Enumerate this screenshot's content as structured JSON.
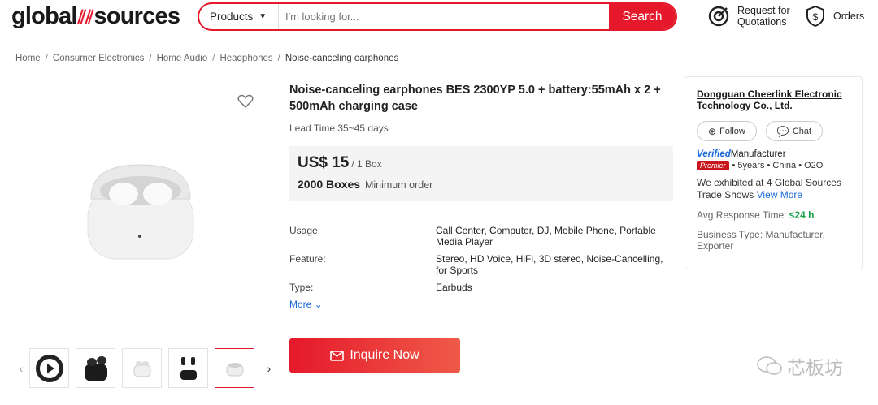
{
  "header": {
    "logo_left": "global",
    "logo_right": "sources",
    "category": "Products",
    "search_placeholder": "I'm looking for...",
    "search_button": "Search",
    "rfq_line1": "Request for",
    "rfq_line2": "Quotations",
    "orders": "Orders"
  },
  "breadcrumb": [
    "Home",
    "Consumer Electronics",
    "Home Audio",
    "Headphones",
    "Noise-canceling earphones"
  ],
  "product": {
    "title": "Noise-canceling earphones BES 2300YP 5.0 + battery:55mAh x 2 + 500mAh charging case",
    "lead_time": "Lead Time 35~45 days",
    "price": "US$ 15",
    "price_unit": "/ 1 Box",
    "moq": "2000 Boxes",
    "moq_label": "Minimum order",
    "attributes": [
      {
        "label": "Usage:",
        "value": "Call Center, Computer, DJ, Mobile Phone, Portable Media Player"
      },
      {
        "label": "Feature:",
        "value": "Stereo, HD Voice, HiFi, 3D stereo, Noise-Cancelling, for Sports"
      },
      {
        "label": "Type:",
        "value": "Earbuds"
      }
    ],
    "more": "More",
    "inquire": "Inquire Now"
  },
  "supplier": {
    "name": "Dongguan Cheerlink Electronic Technology Co., Ltd.",
    "follow": "Follow",
    "chat": "Chat",
    "verified": "Verified",
    "manufacturer": "Manufacturer",
    "premier": "Premier",
    "meta": "• 5years • China • O2O",
    "exhibited": "We exhibited at 4 Global Sources Trade Shows",
    "view_more": "View More",
    "avg_label": "Avg Response Time:",
    "avg_value": "≤24 h",
    "business": "Business Type: Manufacturer, Exporter"
  },
  "watermark": "芯板坊",
  "colors": {
    "brand": "#e5192b",
    "link": "#1a6ad9",
    "good": "#1aa34a"
  }
}
